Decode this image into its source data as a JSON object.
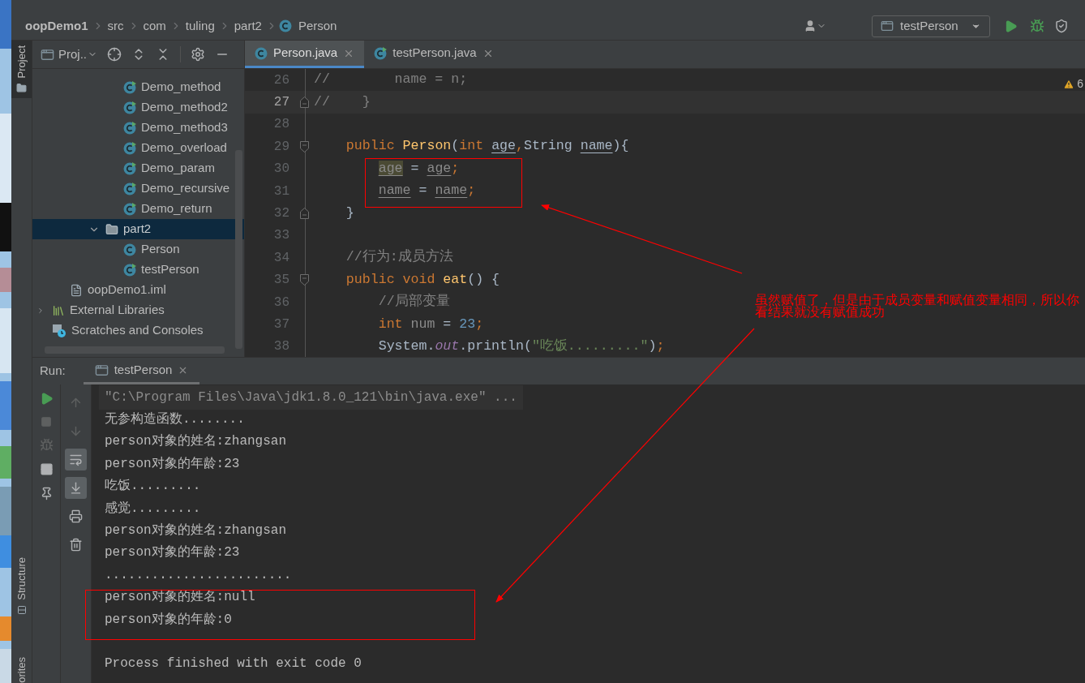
{
  "breadcrumbs": [
    {
      "label": "oopDemo1",
      "kind": "project"
    },
    {
      "label": "src",
      "kind": "folder"
    },
    {
      "label": "com",
      "kind": "folder"
    },
    {
      "label": "tuling",
      "kind": "folder"
    },
    {
      "label": "part2",
      "kind": "folder"
    },
    {
      "label": "Person",
      "kind": "class"
    }
  ],
  "run_config": {
    "label": "testPerson"
  },
  "tool_strip": [
    {
      "label": "Project",
      "selected": true
    },
    {
      "label": "Structure",
      "selected": false
    },
    {
      "label": "orites",
      "selected": false
    }
  ],
  "project_panel": {
    "view": "Proj..",
    "tree": [
      {
        "children": [
          {
            "children": [
              {
                "children": [
                  {
                    "children": [
                      {
                        "label": "Demo_method",
                        "kind": "runnable-class",
                        "selected": false
                      },
                      {
                        "label": "Demo_method2",
                        "kind": "runnable-class",
                        "selected": false
                      },
                      {
                        "label": "Demo_method3",
                        "kind": "runnable-class",
                        "selected": false
                      },
                      {
                        "label": "Demo_overload",
                        "kind": "runnable-class",
                        "selected": false
                      },
                      {
                        "label": "Demo_param",
                        "kind": "runnable-class",
                        "selected": false
                      },
                      {
                        "label": "Demo_recursive",
                        "kind": "runnable-class",
                        "selected": false
                      },
                      {
                        "label": "Demo_return",
                        "kind": "runnable-class",
                        "selected": false
                      }
                    ]
                  },
                  {
                    "label": "part2",
                    "kind": "folder",
                    "expanded": true,
                    "selected": true,
                    "children": [
                      {
                        "label": "Person",
                        "kind": "class",
                        "selected": false
                      },
                      {
                        "label": "testPerson",
                        "kind": "runnable-class",
                        "selected": false
                      }
                    ]
                  }
                ]
              }
            ]
          },
          {
            "label": "oopDemo1.iml",
            "kind": "module-file",
            "selected": false
          }
        ]
      },
      {
        "label": "External Libraries",
        "kind": "libraries",
        "expanded": false,
        "selected": false
      },
      {
        "label": "Scratches and Consoles",
        "kind": "scratches",
        "selected": false
      }
    ]
  },
  "tabs": [
    {
      "label": "Person.java",
      "kind": "class",
      "selected": true
    },
    {
      "label": "testPerson.java",
      "kind": "runnable-class",
      "selected": false
    }
  ],
  "editor": {
    "warnings": "6",
    "lines": [
      {
        "number": "26",
        "current": false,
        "kind": "plain",
        "tokens": [
          {
            "text": "//        name = n;",
            "kind": "comment"
          }
        ]
      },
      {
        "number": "27",
        "current": true,
        "kind": "fold-end",
        "tokens": [
          {
            "text": "//    }",
            "kind": "comment"
          }
        ]
      },
      {
        "number": "28",
        "current": false,
        "kind": "plain"
      },
      {
        "number": "29",
        "current": false,
        "kind": "fold-start",
        "tokens": [
          {
            "text": "    public ",
            "kind": "keyword"
          },
          {
            "text": "Person",
            "kind": "method"
          },
          {
            "text": "(",
            "kind": "plain"
          },
          {
            "text": "int ",
            "kind": "keyword"
          },
          {
            "text": "age",
            "kind": "param"
          },
          {
            "text": ",",
            "kind": "keyword"
          },
          {
            "text": "String ",
            "kind": "plain"
          },
          {
            "text": "name",
            "kind": "param"
          },
          {
            "text": "){",
            "kind": "plain"
          }
        ]
      },
      {
        "number": "30",
        "current": false,
        "kind": "plain",
        "tokens": [
          {
            "text": "        age",
            "kind": "highlighted"
          },
          {
            "text": " = ",
            "kind": "plain"
          },
          {
            "text": "age",
            "kind": "unused"
          },
          {
            "text": ";",
            "kind": "keyword"
          }
        ]
      },
      {
        "number": "31",
        "current": false,
        "kind": "plain",
        "tokens": [
          {
            "text": "        name",
            "kind": "unused"
          },
          {
            "text": " = ",
            "kind": "plain"
          },
          {
            "text": "name",
            "kind": "unused"
          },
          {
            "text": ";",
            "kind": "keyword"
          }
        ]
      },
      {
        "number": "32",
        "current": false,
        "kind": "fold-end",
        "tokens": [
          {
            "text": "    }",
            "kind": "plain"
          }
        ]
      },
      {
        "number": "33",
        "current": false,
        "kind": "plain"
      },
      {
        "number": "34",
        "current": false,
        "kind": "plain",
        "tokens": [
          {
            "text": "    //行为:成员方法",
            "kind": "comment"
          }
        ]
      },
      {
        "number": "35",
        "current": false,
        "kind": "fold-start",
        "tokens": [
          {
            "text": "    public void ",
            "kind": "keyword"
          },
          {
            "text": "eat",
            "kind": "method"
          },
          {
            "text": "() {",
            "kind": "plain"
          }
        ]
      },
      {
        "number": "36",
        "current": false,
        "kind": "plain",
        "tokens": [
          {
            "text": "        //局部变量",
            "kind": "comment"
          }
        ]
      },
      {
        "number": "37",
        "current": false,
        "kind": "plain",
        "tokens": [
          {
            "text": "        int",
            "kind": "keyword"
          },
          {
            "text": " num ",
            "kind": "local"
          },
          {
            "text": "= ",
            "kind": "plain"
          },
          {
            "text": "23",
            "kind": "number"
          },
          {
            "text": ";",
            "kind": "keyword"
          }
        ]
      },
      {
        "number": "38",
        "current": false,
        "kind": "plain",
        "tokens": [
          {
            "text": "        System.",
            "kind": "plain"
          },
          {
            "text": "out",
            "kind": "static"
          },
          {
            "text": ".println(",
            "kind": "plain"
          },
          {
            "text": "\"吃饭.........\"",
            "kind": "string"
          },
          {
            "text": ")",
            "kind": "plain"
          },
          {
            "text": ";",
            "kind": "keyword"
          }
        ]
      }
    ]
  },
  "run_panel": {
    "title": "Run:",
    "tab": "testPerson",
    "actions": [
      {
        "kind": "run",
        "disabled": false
      },
      {
        "kind": "stop",
        "disabled": true
      },
      {
        "kind": "debug",
        "disabled": true
      },
      {
        "kind": "layout",
        "disabled": false
      },
      {
        "kind": "pin",
        "disabled": false
      }
    ],
    "toggles": [
      {
        "kind": "up",
        "on": false,
        "disabled": true
      },
      {
        "kind": "down",
        "on": false,
        "disabled": true
      },
      {
        "kind": "wrap",
        "on": true,
        "disabled": false
      },
      {
        "kind": "scroll-end",
        "on": true,
        "disabled": false
      },
      {
        "kind": "print",
        "on": false,
        "disabled": false
      },
      {
        "kind": "trash",
        "on": false,
        "disabled": false
      }
    ],
    "console": [
      {
        "text": "\"C:\\Program Files\\Java\\jdk1.8.0_121\\bin\\java.exe\" ...",
        "kind": "command"
      },
      {
        "text": "无参构造函数........",
        "kind": "output"
      },
      {
        "text": "person对象的姓名:zhangsan",
        "kind": "output"
      },
      {
        "text": "person对象的年龄:23",
        "kind": "output"
      },
      {
        "text": "吃饭.........",
        "kind": "output"
      },
      {
        "text": "感觉.........",
        "kind": "output"
      },
      {
        "text": "person对象的姓名:zhangsan",
        "kind": "output"
      },
      {
        "text": "person对象的年龄:23",
        "kind": "output"
      },
      {
        "text": "........................",
        "kind": "output"
      },
      {
        "text": "person对象的姓名:null",
        "kind": "output"
      },
      {
        "text": "person对象的年龄:0",
        "kind": "output"
      },
      {
        "text": "Process finished with exit code 0",
        "kind": "exit"
      }
    ]
  },
  "annotation": {
    "note": "虽然赋值了，但是由于成员变量和赋值变量相同，所以你看结果就没有赋值成功"
  }
}
